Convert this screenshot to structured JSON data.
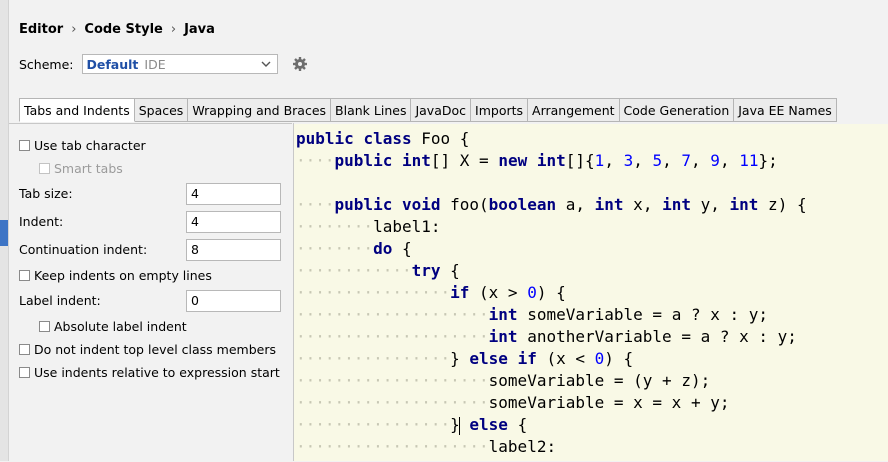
{
  "breadcrumb": [
    "Editor",
    "Code Style",
    "Java"
  ],
  "scheme": {
    "label": "Scheme:",
    "name": "Default",
    "kind": "IDE"
  },
  "icons": {
    "gear": "gear-icon",
    "chevron": "chevron-down-icon",
    "separator": "chevron-right-icon"
  },
  "tabs": [
    "Tabs and Indents",
    "Spaces",
    "Wrapping and Braces",
    "Blank Lines",
    "JavaDoc",
    "Imports",
    "Arrangement",
    "Code Generation",
    "Java EE Names"
  ],
  "active_tab": "Tabs and Indents",
  "options": {
    "use_tab_character": {
      "label": "Use tab character",
      "checked": false
    },
    "smart_tabs": {
      "label": "Smart tabs",
      "checked": false,
      "enabled": false
    },
    "tab_size": {
      "label": "Tab size:",
      "value": "4"
    },
    "indent": {
      "label": "Indent:",
      "value": "4"
    },
    "continuation_indent": {
      "label": "Continuation indent:",
      "value": "8"
    },
    "keep_indents_empty": {
      "label": "Keep indents on empty lines",
      "checked": false
    },
    "label_indent": {
      "label": "Label indent:",
      "value": "0"
    },
    "absolute_label_indent": {
      "label": "Absolute label indent",
      "checked": false
    },
    "no_indent_top_level": {
      "label": "Do not indent top level class members",
      "checked": false
    },
    "indents_relative_expr": {
      "label": "Use indents relative to expression start",
      "checked": false
    }
  },
  "code": [
    "public class Foo {",
    "    public int[] X = new int[]{1, 3, 5, 7, 9, 11};",
    "",
    "    public void foo(boolean a, int x, int y, int z) {",
    "        label1:",
    "        do {",
    "            try {",
    "                if (x > 0) {",
    "                    int someVariable = a ? x : y;",
    "                    int anotherVariable = a ? x : y;",
    "                } else if (x < 0) {",
    "                    someVariable = (y + z);",
    "                    someVariable = x = x + y;",
    "                } else {",
    "                    label2:"
  ],
  "colors": {
    "keyword": "#000080",
    "number": "#0000ff",
    "editor_bg": "#f9f9e6",
    "accent": "#3d74c5"
  }
}
